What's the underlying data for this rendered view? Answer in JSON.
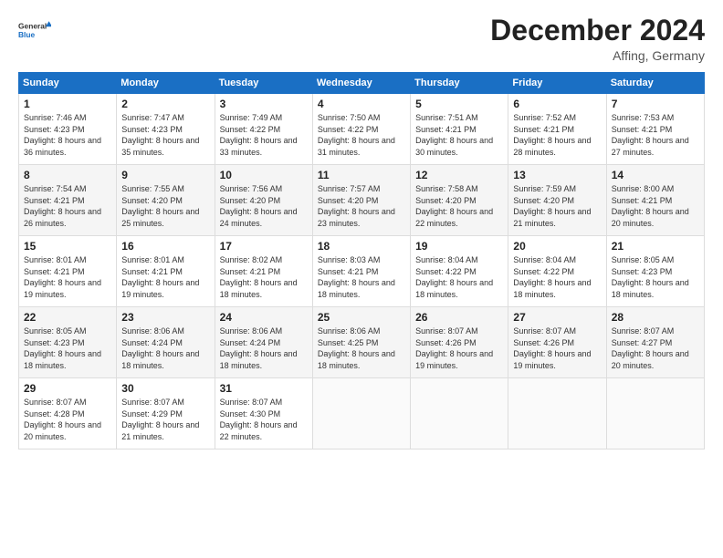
{
  "logo": {
    "text_general": "General",
    "text_blue": "Blue"
  },
  "header": {
    "month": "December 2024",
    "location": "Affing, Germany"
  },
  "days_of_week": [
    "Sunday",
    "Monday",
    "Tuesday",
    "Wednesday",
    "Thursday",
    "Friday",
    "Saturday"
  ],
  "weeks": [
    [
      {
        "day": "1",
        "sunrise": "7:46 AM",
        "sunset": "4:23 PM",
        "daylight": "8 hours and 36 minutes."
      },
      {
        "day": "2",
        "sunrise": "7:47 AM",
        "sunset": "4:23 PM",
        "daylight": "8 hours and 35 minutes."
      },
      {
        "day": "3",
        "sunrise": "7:49 AM",
        "sunset": "4:22 PM",
        "daylight": "8 hours and 33 minutes."
      },
      {
        "day": "4",
        "sunrise": "7:50 AM",
        "sunset": "4:22 PM",
        "daylight": "8 hours and 31 minutes."
      },
      {
        "day": "5",
        "sunrise": "7:51 AM",
        "sunset": "4:21 PM",
        "daylight": "8 hours and 30 minutes."
      },
      {
        "day": "6",
        "sunrise": "7:52 AM",
        "sunset": "4:21 PM",
        "daylight": "8 hours and 28 minutes."
      },
      {
        "day": "7",
        "sunrise": "7:53 AM",
        "sunset": "4:21 PM",
        "daylight": "8 hours and 27 minutes."
      }
    ],
    [
      {
        "day": "8",
        "sunrise": "7:54 AM",
        "sunset": "4:21 PM",
        "daylight": "8 hours and 26 minutes."
      },
      {
        "day": "9",
        "sunrise": "7:55 AM",
        "sunset": "4:20 PM",
        "daylight": "8 hours and 25 minutes."
      },
      {
        "day": "10",
        "sunrise": "7:56 AM",
        "sunset": "4:20 PM",
        "daylight": "8 hours and 24 minutes."
      },
      {
        "day": "11",
        "sunrise": "7:57 AM",
        "sunset": "4:20 PM",
        "daylight": "8 hours and 23 minutes."
      },
      {
        "day": "12",
        "sunrise": "7:58 AM",
        "sunset": "4:20 PM",
        "daylight": "8 hours and 22 minutes."
      },
      {
        "day": "13",
        "sunrise": "7:59 AM",
        "sunset": "4:20 PM",
        "daylight": "8 hours and 21 minutes."
      },
      {
        "day": "14",
        "sunrise": "8:00 AM",
        "sunset": "4:21 PM",
        "daylight": "8 hours and 20 minutes."
      }
    ],
    [
      {
        "day": "15",
        "sunrise": "8:01 AM",
        "sunset": "4:21 PM",
        "daylight": "8 hours and 19 minutes."
      },
      {
        "day": "16",
        "sunrise": "8:01 AM",
        "sunset": "4:21 PM",
        "daylight": "8 hours and 19 minutes."
      },
      {
        "day": "17",
        "sunrise": "8:02 AM",
        "sunset": "4:21 PM",
        "daylight": "8 hours and 18 minutes."
      },
      {
        "day": "18",
        "sunrise": "8:03 AM",
        "sunset": "4:21 PM",
        "daylight": "8 hours and 18 minutes."
      },
      {
        "day": "19",
        "sunrise": "8:04 AM",
        "sunset": "4:22 PM",
        "daylight": "8 hours and 18 minutes."
      },
      {
        "day": "20",
        "sunrise": "8:04 AM",
        "sunset": "4:22 PM",
        "daylight": "8 hours and 18 minutes."
      },
      {
        "day": "21",
        "sunrise": "8:05 AM",
        "sunset": "4:23 PM",
        "daylight": "8 hours and 18 minutes."
      }
    ],
    [
      {
        "day": "22",
        "sunrise": "8:05 AM",
        "sunset": "4:23 PM",
        "daylight": "8 hours and 18 minutes."
      },
      {
        "day": "23",
        "sunrise": "8:06 AM",
        "sunset": "4:24 PM",
        "daylight": "8 hours and 18 minutes."
      },
      {
        "day": "24",
        "sunrise": "8:06 AM",
        "sunset": "4:24 PM",
        "daylight": "8 hours and 18 minutes."
      },
      {
        "day": "25",
        "sunrise": "8:06 AM",
        "sunset": "4:25 PM",
        "daylight": "8 hours and 18 minutes."
      },
      {
        "day": "26",
        "sunrise": "8:07 AM",
        "sunset": "4:26 PM",
        "daylight": "8 hours and 19 minutes."
      },
      {
        "day": "27",
        "sunrise": "8:07 AM",
        "sunset": "4:26 PM",
        "daylight": "8 hours and 19 minutes."
      },
      {
        "day": "28",
        "sunrise": "8:07 AM",
        "sunset": "4:27 PM",
        "daylight": "8 hours and 20 minutes."
      }
    ],
    [
      {
        "day": "29",
        "sunrise": "8:07 AM",
        "sunset": "4:28 PM",
        "daylight": "8 hours and 20 minutes."
      },
      {
        "day": "30",
        "sunrise": "8:07 AM",
        "sunset": "4:29 PM",
        "daylight": "8 hours and 21 minutes."
      },
      {
        "day": "31",
        "sunrise": "8:07 AM",
        "sunset": "4:30 PM",
        "daylight": "8 hours and 22 minutes."
      },
      null,
      null,
      null,
      null
    ]
  ],
  "labels": {
    "sunrise": "Sunrise:",
    "sunset": "Sunset:",
    "daylight": "Daylight:"
  }
}
